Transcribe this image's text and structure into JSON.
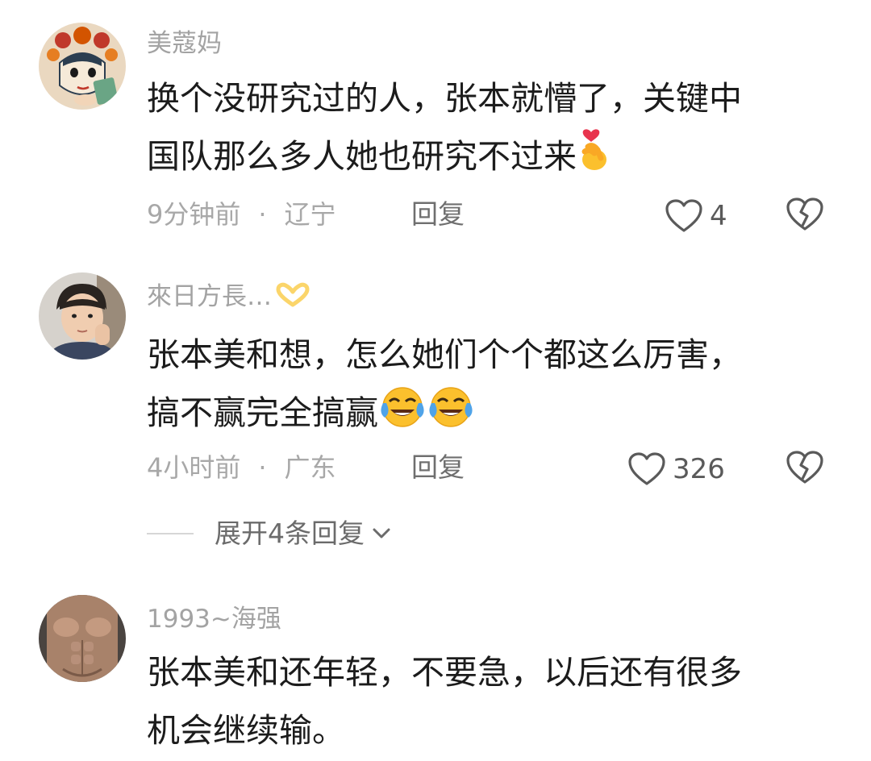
{
  "comments": [
    {
      "username": "美蔻妈",
      "lines": [
        "换个没研究过的人，张本就懵了，关键中",
        "国队那么多人她也研究不过来"
      ],
      "time": "9分钟前",
      "location": "辽宁",
      "reply_label": "回复",
      "likes": "4",
      "emoji": "finger-heart-emoji"
    },
    {
      "username": "來日方長…",
      "lines": [
        "张本美和想，怎么她们个个都这么厉害，",
        "搞不赢完全搞赢"
      ],
      "time": "4小时前",
      "location": "广东",
      "reply_label": "回复",
      "likes": "326",
      "emoji": "laughing-crying-emoji",
      "expand_label": "展开4条回复"
    },
    {
      "username": "1993~海强",
      "lines": [
        "张本美和还年轻，不要急，以后还有很多",
        "机会继续输。"
      ]
    }
  ],
  "separator": "·",
  "colors": {
    "text": "#1c1c1c",
    "muted": "#a8a8a8",
    "action": "#6f6f6f",
    "background": "#ffffff"
  }
}
